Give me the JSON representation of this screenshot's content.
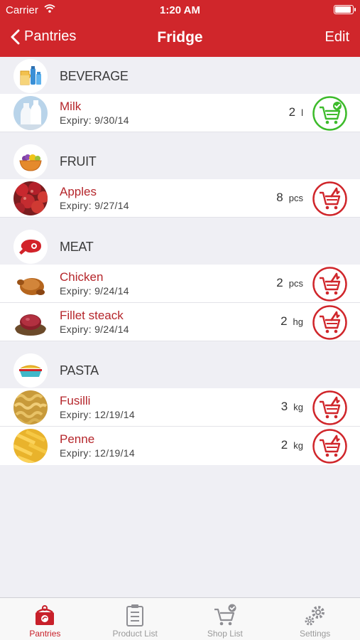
{
  "status": {
    "carrier": "Carrier",
    "time": "1:20 AM"
  },
  "nav": {
    "back_label": "Pantries",
    "title": "Fridge",
    "edit_label": "Edit"
  },
  "sections": [
    {
      "label": "BEVERAGE",
      "icon": "beverage-icon",
      "items": [
        {
          "name": "Milk",
          "expiry": "Expiry: 9/30/14",
          "qty": "2",
          "unit": "l",
          "in_cart": true
        }
      ]
    },
    {
      "label": "FRUIT",
      "icon": "fruit-icon",
      "items": [
        {
          "name": "Apples",
          "expiry": "Expiry: 9/27/14",
          "qty": "8",
          "unit": "pcs",
          "in_cart": false
        }
      ]
    },
    {
      "label": "MEAT",
      "icon": "meat-icon",
      "items": [
        {
          "name": "Chicken",
          "expiry": "Expiry: 9/24/14",
          "qty": "2",
          "unit": "pcs",
          "in_cart": false
        },
        {
          "name": "Fillet steack",
          "expiry": "Expiry: 9/24/14",
          "qty": "2",
          "unit": "hg",
          "in_cart": false
        }
      ]
    },
    {
      "label": "PASTA",
      "icon": "pasta-icon",
      "items": [
        {
          "name": "Fusilli",
          "expiry": "Expiry: 12/19/14",
          "qty": "3",
          "unit": "kg",
          "in_cart": false
        },
        {
          "name": "Penne",
          "expiry": "Expiry: 12/19/14",
          "qty": "2",
          "unit": "kg",
          "in_cart": false
        }
      ]
    }
  ],
  "tabs": [
    {
      "label": "Pantries",
      "icon": "pantries-icon",
      "active": true
    },
    {
      "label": "Product List",
      "icon": "product-list-icon",
      "active": false
    },
    {
      "label": "Shop List",
      "icon": "shop-list-icon",
      "active": false
    },
    {
      "label": "Settings",
      "icon": "settings-icon",
      "active": false
    }
  ],
  "colors": {
    "brand": "#d0262b",
    "item_name": "#b5262b",
    "cart_add": "#d0262b",
    "cart_added": "#3dbb2b"
  }
}
